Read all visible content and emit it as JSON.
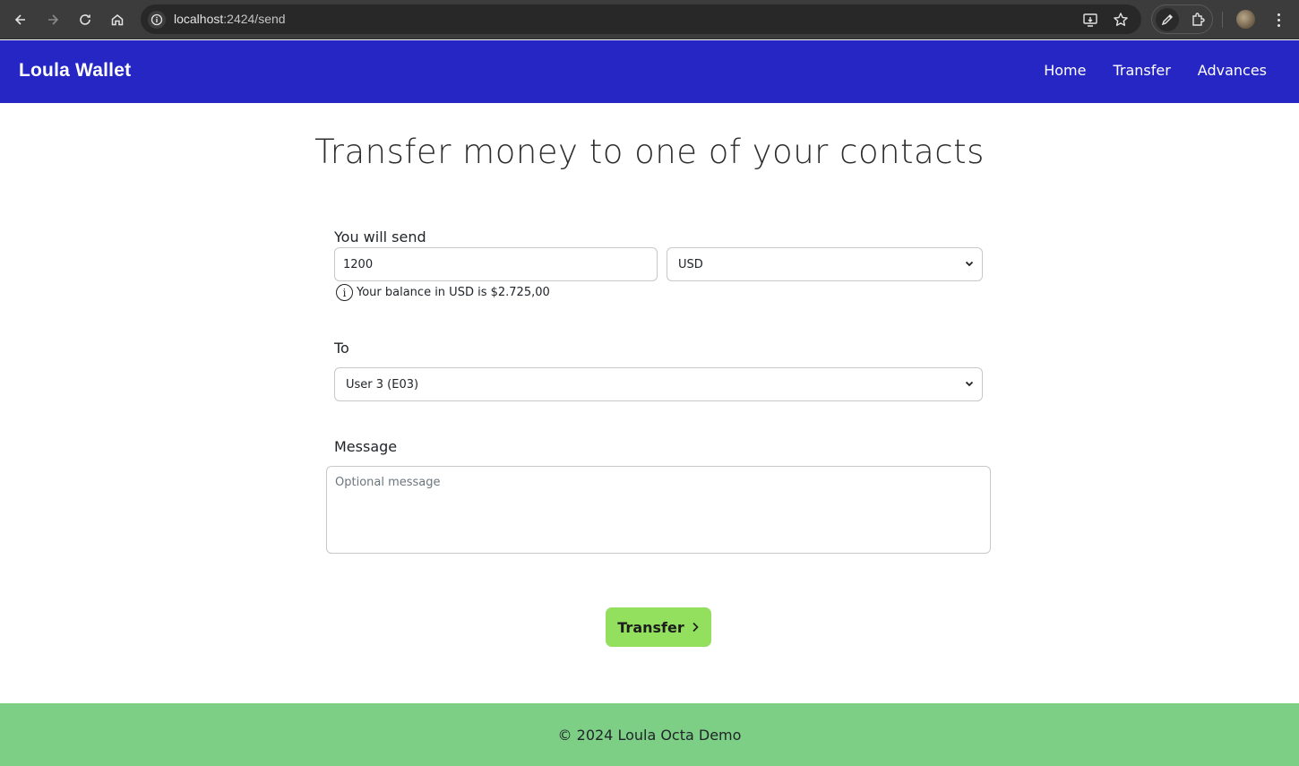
{
  "browser": {
    "url_host": "localhost",
    "url_path": ":2424/send"
  },
  "header": {
    "brand": "Loula Wallet",
    "nav": [
      "Home",
      "Transfer",
      "Advances"
    ],
    "background": "#2626c5"
  },
  "main": {
    "title": "Transfer money to one of your contacts",
    "send": {
      "label": "You will send",
      "amount": "1200",
      "currency": "USD",
      "balance_text": "Your balance in USD is $2.725,00"
    },
    "to": {
      "label": "To",
      "selected": "User 3 (E03)"
    },
    "message": {
      "label": "Message",
      "placeholder": "Optional message"
    },
    "submit_label": "Transfer",
    "submit_color": "#92e05e"
  },
  "footer": {
    "text": "© 2024 Loula Octa Demo",
    "background": "#7dcf86"
  }
}
